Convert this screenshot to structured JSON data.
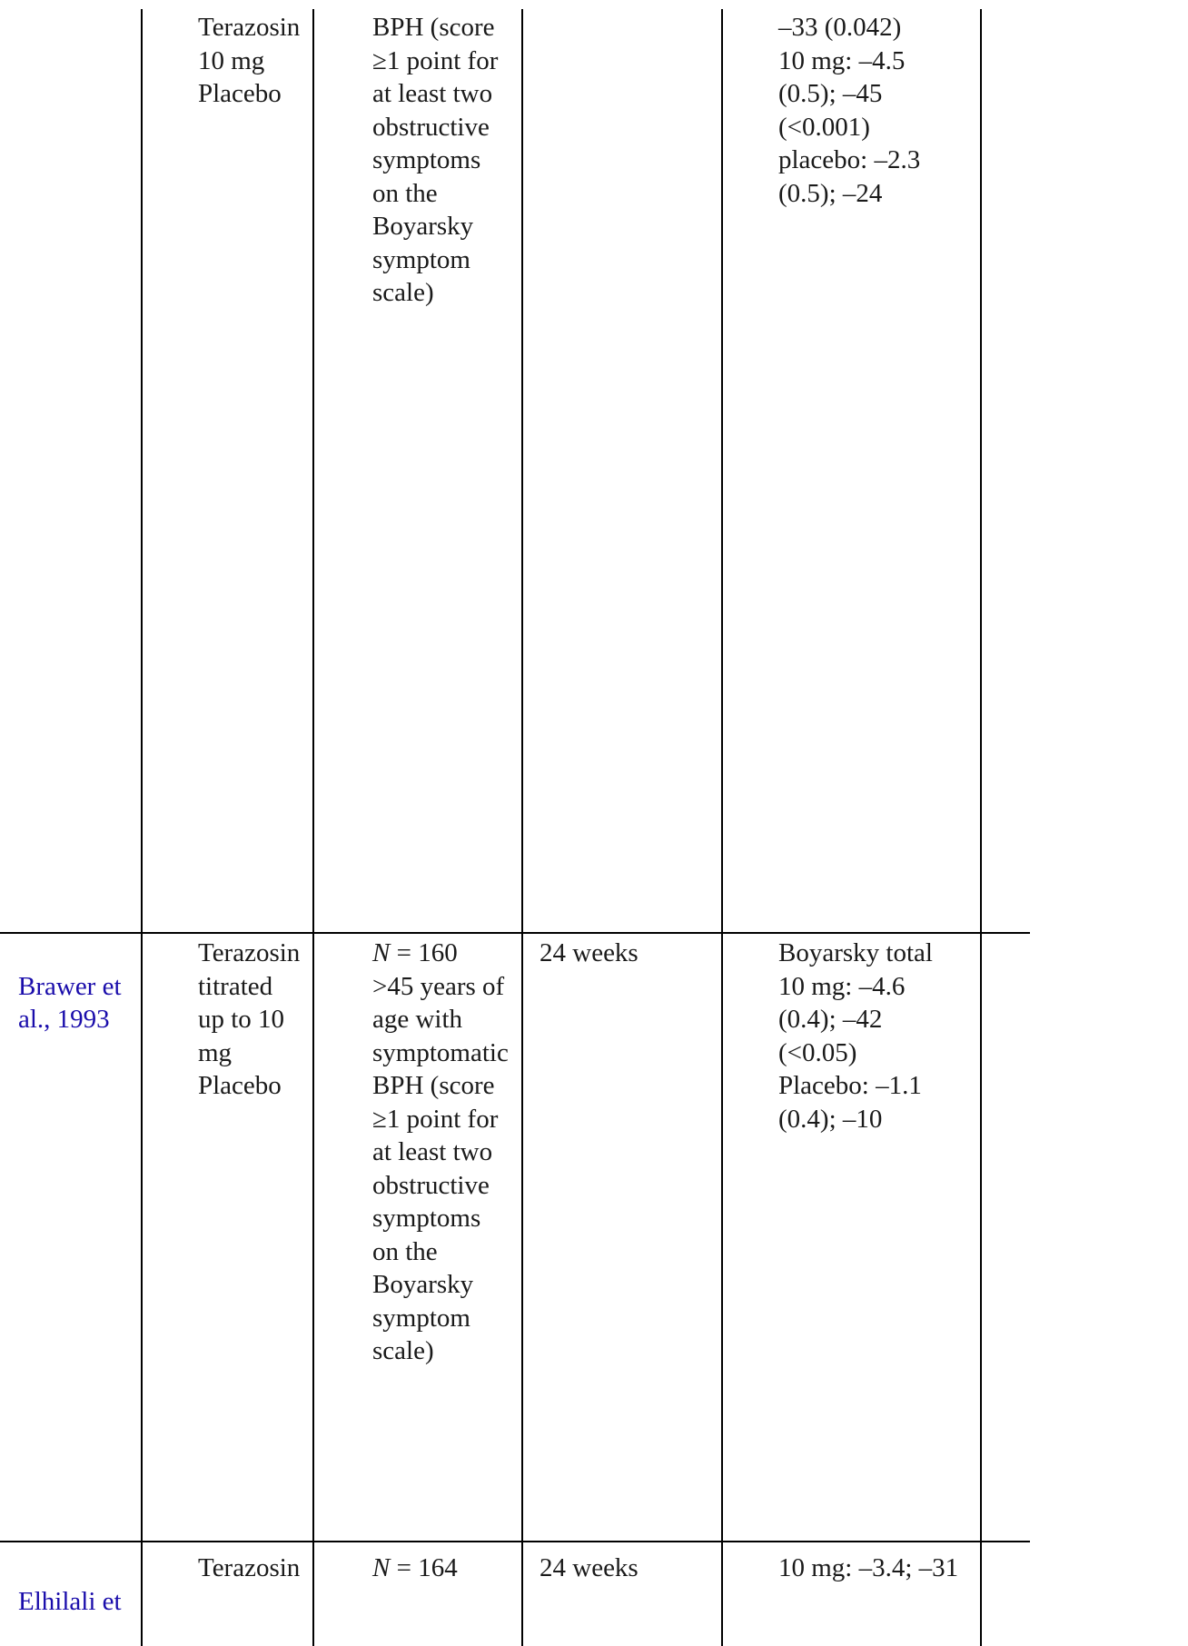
{
  "rows": [
    {
      "study": "",
      "treatment": "Terazosin\n10 mg\nPlacebo",
      "population": "BPH (score\n≥1 point for\nat least two\nobstructive\nsymptoms\non the\nBoyarsky\nsymptom\nscale)",
      "duration": "",
      "result": "–33 (0.042)\n10 mg: –4.5\n(0.5); –45\n(<0.001)\nplacebo: –2.3\n(0.5); –24"
    },
    {
      "study": "Brawer et\nal., 1993",
      "treatment": "Terazosin\ntitrated\nup to 10\nmg\nPlacebo",
      "population_n_label": "N",
      "population_n_value": " = 160",
      "population_rest": ">45 years of\nage with\nsymptomatic\nBPH (score\n≥1 point for\nat least two\nobstructive\nsymptoms\non the\nBoyarsky\nsymptom\nscale)",
      "duration": "24 weeks",
      "result": "Boyarsky total\n10 mg: –4.6\n(0.4); –42\n(<0.05)\nPlacebo: –1.1\n(0.4); –10"
    },
    {
      "study": "Elhilali et",
      "treatment": "Terazosin",
      "population_n_label": "N",
      "population_n_value": " = 164",
      "duration": "24 weeks",
      "result": "10 mg: –3.4; –31"
    }
  ],
  "colors": {
    "text": "#1a1a1a",
    "link": "#1a0dab",
    "border": "#000000"
  }
}
